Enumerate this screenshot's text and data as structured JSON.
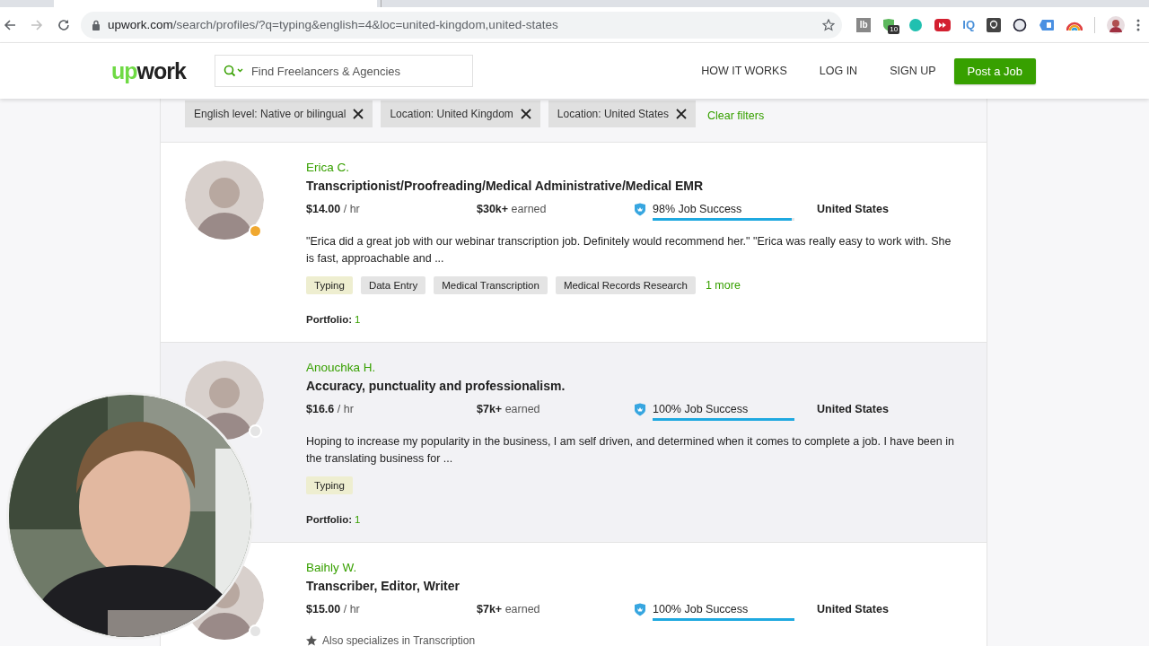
{
  "browser": {
    "address": {
      "host": "upwork.com",
      "path": "/search/profiles/?q=typing&english=4&loc=united-kingdom,united-states"
    },
    "extensions": [
      {
        "kind": "lb",
        "label": "lb"
      },
      {
        "kind": "shield",
        "badge": "10"
      },
      {
        "kind": "dot"
      },
      {
        "kind": "play"
      },
      {
        "kind": "iq",
        "label": "IQ"
      },
      {
        "kind": "bulb"
      },
      {
        "kind": "ring"
      },
      {
        "kind": "panel"
      },
      {
        "kind": "rainbow"
      }
    ]
  },
  "header": {
    "logo": {
      "accent": "up",
      "rest": "work"
    },
    "search": {
      "placeholder": "Find Freelancers & Agencies"
    },
    "nav": [
      "HOW IT WORKS",
      "LOG IN",
      "SIGN UP"
    ],
    "post_button": "Post a Job"
  },
  "filters": {
    "chips": [
      "English level: Native or bilingual",
      "Location: United Kingdom",
      "Location: United States"
    ],
    "clear": "Clear filters"
  },
  "freelancers": [
    {
      "name": "Erica C.",
      "title": "Transcriptionist/Proofreading/Medical Administrative/Medical EMR",
      "rate": "$14.00",
      "rate_unit": "/ hr",
      "earned": "$30k+",
      "earned_label": "earned",
      "job_success": "98% Job Success",
      "level": 0.98,
      "country": "United States",
      "color": "#f0a830",
      "hovered": false,
      "description": "\"Erica did a great job with our webinar transcription job. Definitely would recommend her.\" \"Erica was really easy to work with. She is fast, approachable and ...",
      "skills": [
        {
          "label": "Typing",
          "highlighted": true
        },
        {
          "label": "Data Entry",
          "highlighted": false
        },
        {
          "label": "Medical Transcription",
          "highlighted": false
        },
        {
          "label": "Medical Records Research",
          "highlighted": false
        }
      ],
      "more": "1 more",
      "portfolio_label": "Portfolio:",
      "portfolio_count": "1"
    },
    {
      "name": "Anouchka H.",
      "title": "Accuracy, punctuality and professionalism.",
      "rate": "$16.6",
      "rate_unit": "/ hr",
      "earned": "$7k+",
      "earned_label": "earned",
      "job_success": "100% Job Success",
      "level": 1,
      "country": "United States",
      "color": "#e4e4e4",
      "hovered": true,
      "description": "Hoping to increase my popularity in the business, I am self driven, and determined when it comes to complete a job. I have been in the translating business for ...",
      "skills": [
        {
          "label": "Typing",
          "highlighted": true
        }
      ],
      "portfolio_label": "Portfolio:",
      "portfolio_count": "1"
    },
    {
      "name": "Baihly W.",
      "title": "Transcriber, Editor, Writer",
      "rate": "$15.00",
      "rate_unit": "/ hr",
      "earned": "$7k+",
      "earned_label": "earned",
      "job_success": "100% Job Success",
      "level": 1,
      "country": "United States",
      "color": "#e4e4e4",
      "hovered": false,
      "specialization": "Also specializes in Transcription"
    }
  ]
}
